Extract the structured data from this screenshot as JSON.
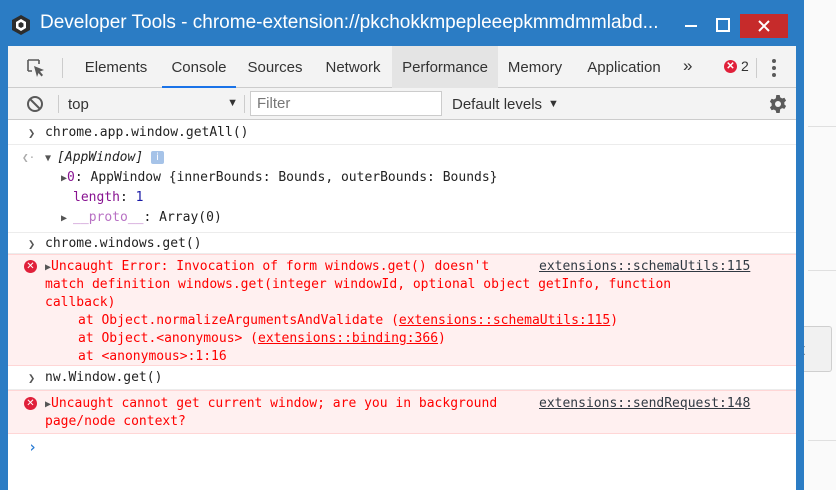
{
  "window": {
    "title": "Developer Tools - chrome-extension://pkchokkmpepleeepkmmdmmlabd..."
  },
  "background": {
    "button_text": "t"
  },
  "tabs": [
    {
      "label": "Elements",
      "state": "normal"
    },
    {
      "label": "Console",
      "state": "active"
    },
    {
      "label": "Sources",
      "state": "normal"
    },
    {
      "label": "Network",
      "state": "normal"
    },
    {
      "label": "Performance",
      "state": "hover"
    },
    {
      "label": "Memory",
      "state": "normal"
    },
    {
      "label": "Application",
      "state": "normal"
    }
  ],
  "toolbar": {
    "overflow": "»",
    "error_count": "2"
  },
  "filterbar": {
    "context": "top",
    "filter_placeholder": "Filter",
    "levels": "Default levels"
  },
  "console": {
    "cmd1": "chrome.app.window.getAll()",
    "result1": {
      "header": "[AppWindow]",
      "item0_key": "0",
      "item0_text": ": AppWindow {innerBounds: Bounds, outerBounds: Bounds}",
      "length_key": "length",
      "length_val": "1",
      "proto_key": "__proto__",
      "proto_val": ": Array(0)"
    },
    "cmd2": "chrome.windows.get()",
    "error1": {
      "line1": "Uncaught Error: Invocation of form windows.get() doesn't",
      "source": "extensions::schemaUtils:115",
      "line2": "match definition windows.get(integer windowId, optional object getInfo, function",
      "line3": "callback)",
      "stack1_pre": "at Object.normalizeArgumentsAndValidate (",
      "stack1_link": "extensions::schemaUtils:115",
      "stack1_post": ")",
      "stack2_pre": "at Object.<anonymous> (",
      "stack2_link": "extensions::binding:366",
      "stack2_post": ")",
      "stack3": "at <anonymous>:1:16"
    },
    "cmd3": "nw.Window.get()",
    "error2": {
      "line1": "Uncaught cannot get current window; are you in background",
      "source": "extensions::sendRequest:148",
      "line2": "page/node context?"
    }
  },
  "colors": {
    "titlebar": "#2b7cc4",
    "close_button": "#c62b2b",
    "error_text": "#ff0000",
    "error_bg": "#fff0f0",
    "active_tab_underline": "#1a73e8"
  }
}
